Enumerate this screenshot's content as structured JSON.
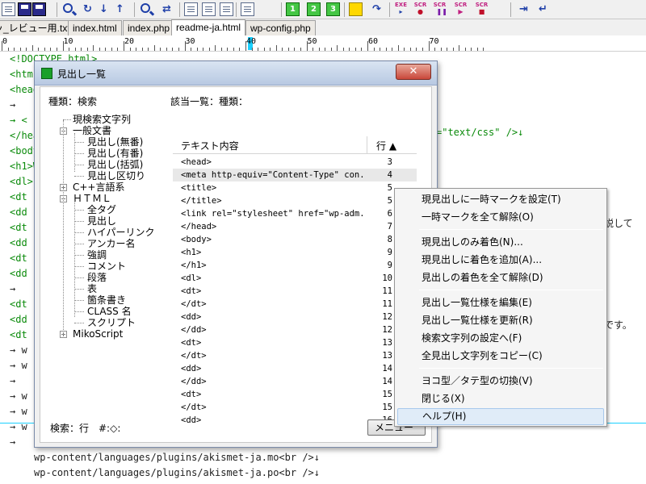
{
  "toolbar": {
    "icons": [
      "new-file-icon",
      "save-icon",
      "save-all-icon",
      "search-icon",
      "find-replace-icon",
      "find-next-icon",
      "find-previous-icon",
      "grep-icon",
      "replace-icon",
      "outline-icon",
      "bookmark-icon",
      "window-icon",
      "list-icon",
      "marker-1-icon",
      "marker-2-icon",
      "marker-3-icon",
      "yellow-highlight-icon",
      "jump-icon",
      "script-exec-icon",
      "script-record-icon",
      "script-pause-icon",
      "script-run-icon",
      "script-stop-icon",
      "goto-icon",
      "return-icon"
    ],
    "scr_labels": [
      "EXE",
      "SCR",
      "SCR",
      "SCR",
      "SCR"
    ],
    "marker_numbers": [
      "1",
      "2",
      "3"
    ]
  },
  "tabs": [
    {
      "label": "ッ_レビュー用.txt",
      "active": false
    },
    {
      "label": "index.html",
      "active": false
    },
    {
      "label": "index.php",
      "active": false
    },
    {
      "label": "readme-ja.html",
      "active": true
    },
    {
      "label": "wp-config.php",
      "active": false
    }
  ],
  "ruler": {
    "numbers": [
      "0",
      "10",
      "20",
      "30",
      "40",
      "50",
      "60",
      "70"
    ]
  },
  "editor": {
    "lines": [
      {
        "text": "<!DOCTYPE html>",
        "kind": "tag"
      },
      {
        "text": "<htm",
        "kind": "tag"
      },
      {
        "text": "<head",
        "kind": "tag"
      },
      {
        "text": "→",
        "kind": "plain"
      },
      {
        "text": "→  <",
        "kind": "tag"
      },
      {
        "text": "</hea",
        "kind": "tag"
      },
      {
        "text": "<body",
        "kind": "tag"
      },
      {
        "text": "<h1>W",
        "kind": "tag"
      },
      {
        "text": "<dl>",
        "kind": "tag"
      },
      {
        "text": "  <dt",
        "kind": "tag"
      },
      {
        "text": "  <dd",
        "kind": "tag"
      },
      {
        "text": "  <dt",
        "kind": "tag"
      },
      {
        "text": "  <dd",
        "kind": "tag"
      },
      {
        "text": "  <dt",
        "kind": "tag"
      },
      {
        "text": "  <dd",
        "kind": "tag"
      },
      {
        "text": "→",
        "kind": "plain"
      },
      {
        "text": "  <dt",
        "kind": "tag"
      },
      {
        "text": "  <dd",
        "kind": "tag"
      },
      {
        "text": "  <dt",
        "kind": "tag"
      },
      {
        "text": "→  w",
        "kind": "plain"
      },
      {
        "text": "→  w",
        "kind": "plain"
      },
      {
        "text": "→",
        "kind": "plain"
      },
      {
        "text": "→  w",
        "kind": "plain"
      },
      {
        "text": "→  w",
        "kind": "plain"
      },
      {
        "text": "→  w",
        "kind": "plain"
      },
      {
        "text": "→",
        "kind": "plain"
      },
      {
        "text": "wp-content/languages/plugins/akismet-ja.mo<br />↓",
        "kind": "plain"
      },
      {
        "text": "wp-content/languages/plugins/akismet-ja.po<br />↓",
        "kind": "plain"
      }
    ],
    "right_fragments": [
      "=\"text/css\" />↓",
      "解説して",
      "ンです。"
    ]
  },
  "dialog": {
    "title": "見出し一覧",
    "close_label": "✕",
    "kind_label": "種類：検索",
    "list_label": "該当一覧：種類：",
    "tree": [
      {
        "label": "現検索文字列",
        "level": 0,
        "expander": ""
      },
      {
        "label": "一般文書",
        "level": 0,
        "expander": "−"
      },
      {
        "label": "見出し(無番)",
        "level": 1,
        "expander": ""
      },
      {
        "label": "見出し(有番)",
        "level": 1,
        "expander": ""
      },
      {
        "label": "見出し(括弧)",
        "level": 1,
        "expander": ""
      },
      {
        "label": "見出し区切り",
        "level": 1,
        "expander": ""
      },
      {
        "label": "C++言語系",
        "level": 0,
        "expander": "+"
      },
      {
        "label": "ＨＴＭＬ",
        "level": 0,
        "expander": "−"
      },
      {
        "label": "全タグ",
        "level": 1,
        "expander": ""
      },
      {
        "label": "見出し",
        "level": 1,
        "expander": ""
      },
      {
        "label": "ハイパーリンク",
        "level": 1,
        "expander": ""
      },
      {
        "label": "アンカー名",
        "level": 1,
        "expander": ""
      },
      {
        "label": "強調",
        "level": 1,
        "expander": ""
      },
      {
        "label": "コメント",
        "level": 1,
        "expander": ""
      },
      {
        "label": "段落",
        "level": 1,
        "expander": ""
      },
      {
        "label": "表",
        "level": 1,
        "expander": ""
      },
      {
        "label": "箇条書き",
        "level": 1,
        "expander": ""
      },
      {
        "label": "CLASS 名",
        "level": 1,
        "expander": ""
      },
      {
        "label": "スクリプト",
        "level": 1,
        "expander": ""
      },
      {
        "label": "MikoScript",
        "level": 0,
        "expander": "+"
      }
    ],
    "list_header": {
      "text": "テキスト内容",
      "line": "行 ▲"
    },
    "list_rows": [
      {
        "text": "<head>",
        "line": "3"
      },
      {
        "text": "<meta http-equiv=\"Content-Type\" con...",
        "line": "4"
      },
      {
        "text": "<title>",
        "line": "5"
      },
      {
        "text": "</title>",
        "line": "5"
      },
      {
        "text": "<link rel=\"stylesheet\" href=\"wp-adm...",
        "line": "6"
      },
      {
        "text": "</head>",
        "line": "7"
      },
      {
        "text": "<body>",
        "line": "8"
      },
      {
        "text": "<h1>",
        "line": "9"
      },
      {
        "text": "</h1>",
        "line": "9"
      },
      {
        "text": "<dl>",
        "line": "10"
      },
      {
        "text": "<dt>",
        "line": "11"
      },
      {
        "text": "</dt>",
        "line": "11"
      },
      {
        "text": "<dd>",
        "line": "12"
      },
      {
        "text": "</dd>",
        "line": "12"
      },
      {
        "text": "<dt>",
        "line": "13"
      },
      {
        "text": "</dt>",
        "line": "13"
      },
      {
        "text": "<dd>",
        "line": "14"
      },
      {
        "text": "</dd>",
        "line": "14"
      },
      {
        "text": "<dt>",
        "line": "15"
      },
      {
        "text": "</dt>",
        "line": "15"
      },
      {
        "text": "<dd>",
        "line": "16"
      }
    ],
    "search_status": "検索：行　#:◇:",
    "menu_button": "メニュー"
  },
  "context_menu": {
    "items": [
      {
        "label": "現見出しに一時マークを設定(T)",
        "group": 0
      },
      {
        "label": "一時マークを全て解除(O)",
        "group": 0
      },
      {
        "label": "現見出しのみ着色(N)...",
        "group": 1
      },
      {
        "label": "現見出しに着色を追加(A)...",
        "group": 1
      },
      {
        "label": "見出しの着色を全て解除(D)",
        "group": 1
      },
      {
        "label": "見出し一覧仕様を編集(E)",
        "group": 2
      },
      {
        "label": "見出し一覧仕様を更新(R)",
        "group": 2
      },
      {
        "label": "検索文字列の設定へ(F)",
        "group": 2
      },
      {
        "label": "全見出し文字列をコピー(C)",
        "group": 2
      },
      {
        "label": "ヨコ型／タテ型の切換(V)",
        "group": 3
      },
      {
        "label": "閉じる(X)",
        "group": 3
      },
      {
        "label": "ヘルプ(H)",
        "group": 3,
        "highlighted": true
      }
    ]
  },
  "colors": {
    "tag_green": "#0a8a0a",
    "cursor_cyan": "#1ad0ff",
    "menu_highlight": "#e0ecf8"
  }
}
